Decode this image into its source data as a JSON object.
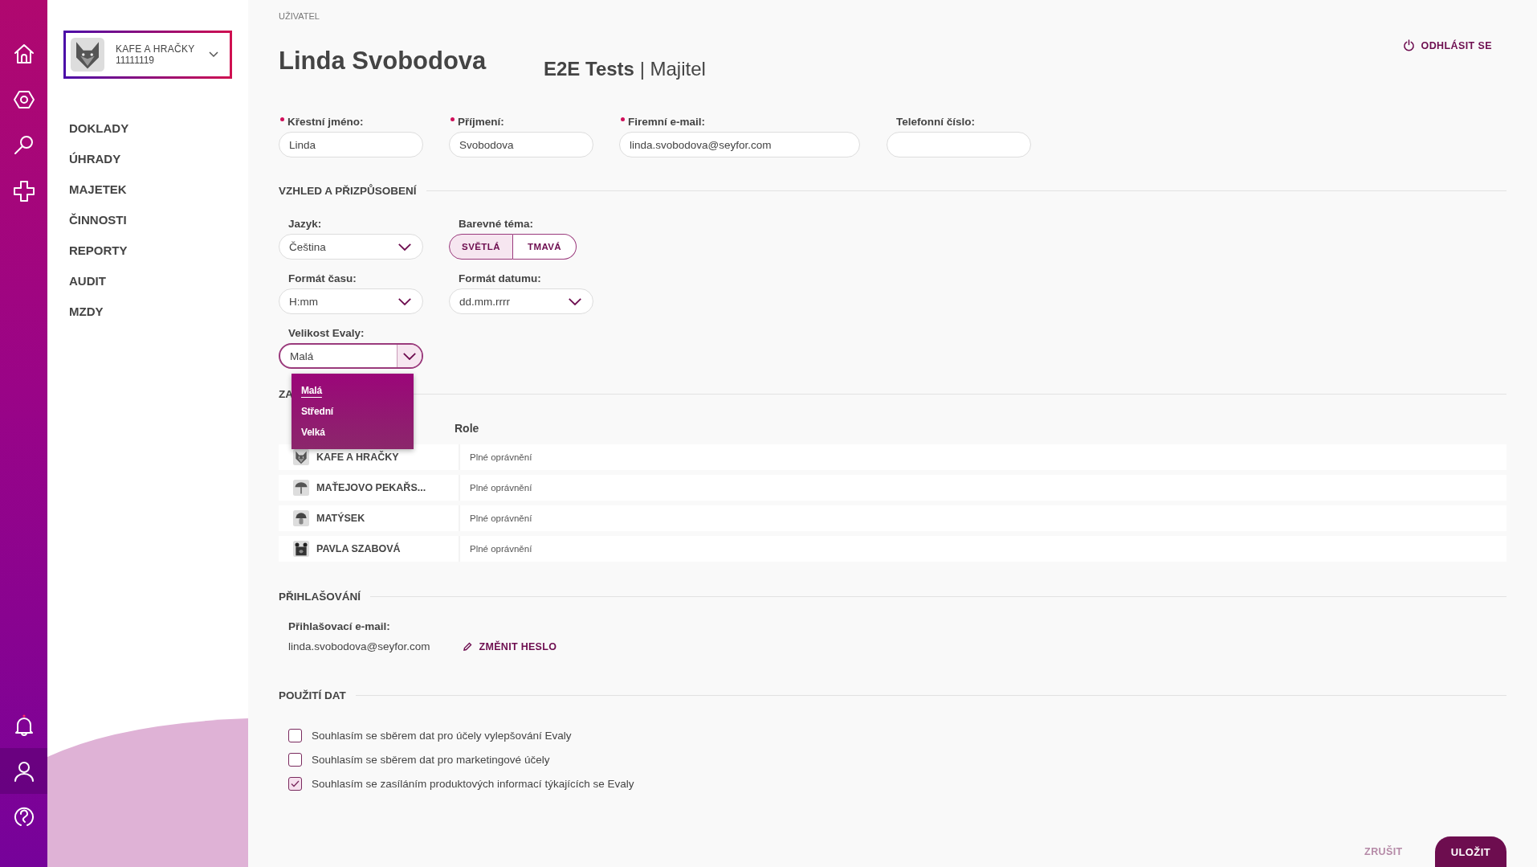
{
  "rail": [
    {
      "kind": "home",
      "selected": false
    },
    {
      "kind": "hexagon",
      "selected": false
    },
    {
      "kind": "search",
      "selected": false
    },
    {
      "kind": "plus",
      "selected": false
    },
    {
      "kind": "bell",
      "selected": false
    },
    {
      "kind": "user",
      "selected": true
    },
    {
      "kind": "help",
      "selected": false
    }
  ],
  "account": {
    "name": "KAFE A HRAČKY",
    "id": "11111119"
  },
  "nav": [
    "DOKLADY",
    "ÚHRADY",
    "MAJETEK",
    "ČINNOSTI",
    "REPORTY",
    "AUDIT",
    "MZDY"
  ],
  "header": {
    "breadcrumb": "UŽIVATEL",
    "name": "Linda Svobodova",
    "org": "E2E Tests",
    "separator": "|",
    "role": "Majitel",
    "logout": "ODHLÁSIT SE"
  },
  "fields": [
    {
      "label": "Křestní jméno:",
      "required": true,
      "value": "Linda"
    },
    {
      "label": "Příjmení:",
      "required": true,
      "value": "Svobodova"
    },
    {
      "label": "Firemní e-mail:",
      "required": true,
      "value": "linda.svobodova@seyfor.com"
    },
    {
      "label": "Telefonní číslo:",
      "required": false
    }
  ],
  "appearance": {
    "title": "VZHLED A PŘIZPŮSOBENÍ",
    "controls": [
      {
        "kind": "select",
        "label": "Jazyk:",
        "value": "Čeština",
        "expanded": false
      },
      {
        "kind": "toggle",
        "label": "Barevné téma:",
        "options": [
          {
            "label": "SVĚTLÁ",
            "selected": true
          },
          {
            "label": "TMAVÁ",
            "selected": false
          }
        ]
      },
      {
        "kind": "select",
        "label": "Formát času:",
        "value": "H:mm",
        "expanded": false
      },
      {
        "kind": "select",
        "label": "Formát datumu:",
        "value": "dd.mm.rrrr",
        "expanded": false
      },
      {
        "kind": "select",
        "label": "Velikost Evaly:",
        "value": "Malá",
        "expanded": true,
        "options": [
          {
            "label": "Malá",
            "selected": true
          },
          {
            "label": "Střední",
            "selected": false
          },
          {
            "label": "Velká",
            "selected": false
          }
        ]
      }
    ]
  },
  "companies": {
    "title": "ZA",
    "role_header": "Role",
    "rows": [
      {
        "name": "KAFE A HRAČKY",
        "role": "Plné oprávnění"
      },
      {
        "name": "MAŤEJOVO PEKAŘS...",
        "role": "Plné oprávnění"
      },
      {
        "name": "MATÝSEK",
        "role": "Plné oprávnění"
      },
      {
        "name": "PAVLA SZABOVÁ",
        "role": "Plné oprávnění"
      }
    ]
  },
  "login": {
    "title": "PŘIHLAŠOVÁNÍ",
    "label": "Přihlašovací e-mail:",
    "email": "linda.svobodova@seyfor.com",
    "change_password": "ZMĚNIT HESLO"
  },
  "data_usage": {
    "title": "POUŽITÍ DAT",
    "consents": [
      {
        "label": "Souhlasím se sběrem dat pro účely vylepšování Evaly",
        "checked": false
      },
      {
        "label": "Souhlasím se sběrem dat pro marketingové účely",
        "checked": false
      },
      {
        "label": "Souhlasím se zasíláním produktových informací týkajících se Evaly",
        "checked": true
      }
    ]
  },
  "footer": {
    "cancel": "ZRUŠIT",
    "save": "ULOŽIT"
  }
}
